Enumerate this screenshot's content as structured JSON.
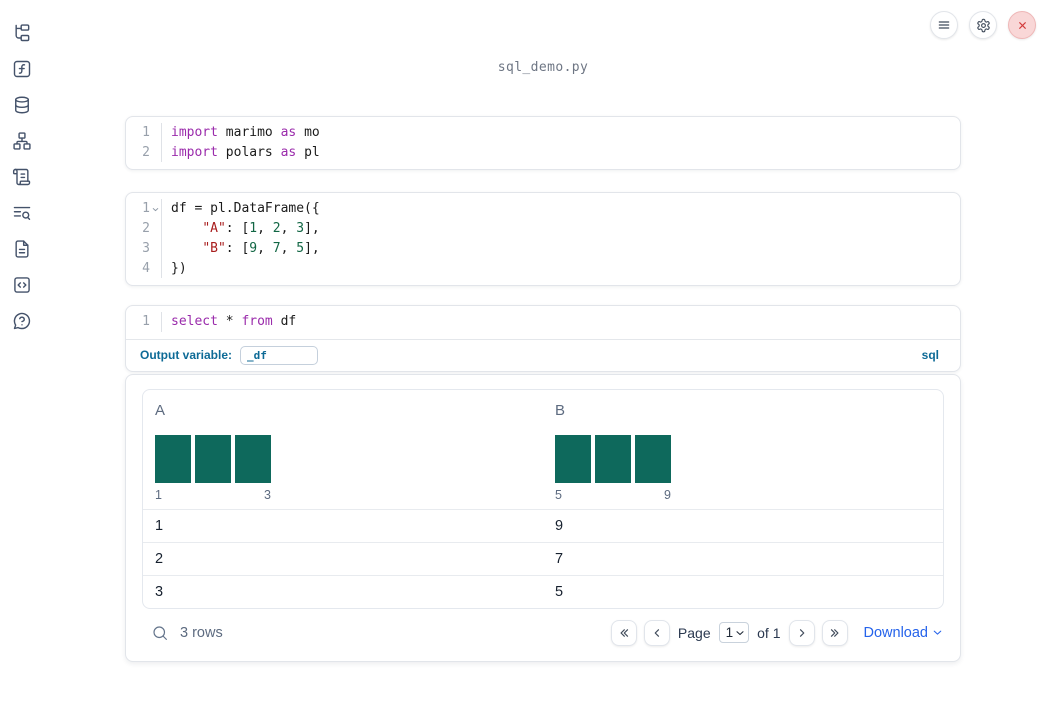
{
  "header": {
    "title": "sql_demo.py"
  },
  "sidebar": {
    "items": [
      {
        "name": "files-panel",
        "icon": "file-tree"
      },
      {
        "name": "variables-panel",
        "icon": "function-square"
      },
      {
        "name": "datasources-panel",
        "icon": "database"
      },
      {
        "name": "dependencies-panel",
        "icon": "dependency-graph"
      },
      {
        "name": "logs-panel",
        "icon": "scroll"
      },
      {
        "name": "outline-search-panel",
        "icon": "text-search"
      },
      {
        "name": "documentation-panel",
        "icon": "file-text"
      },
      {
        "name": "snippets-panel",
        "icon": "code-snippet"
      },
      {
        "name": "help-panel",
        "icon": "help-circle"
      }
    ]
  },
  "topbar": {
    "buttons": [
      {
        "name": "notebook-menu-button",
        "icon": "menu"
      },
      {
        "name": "settings-button",
        "icon": "settings"
      },
      {
        "name": "shutdown-button",
        "icon": "close",
        "danger": true
      }
    ]
  },
  "cells": [
    {
      "type": "code",
      "lines": [
        {
          "num": "1",
          "tokens": [
            {
              "t": "import",
              "c": "keyword"
            },
            {
              "t": " marimo ",
              "c": "plain"
            },
            {
              "t": "as",
              "c": "keyword"
            },
            {
              "t": " mo",
              "c": "plain"
            }
          ]
        },
        {
          "num": "2",
          "tokens": [
            {
              "t": "import",
              "c": "keyword"
            },
            {
              "t": " polars ",
              "c": "plain"
            },
            {
              "t": "as",
              "c": "keyword"
            },
            {
              "t": " pl",
              "c": "plain"
            }
          ]
        }
      ]
    },
    {
      "type": "code",
      "lines": [
        {
          "num": "1",
          "fold": true,
          "tokens": [
            {
              "t": "df = pl.DataFrame({",
              "c": "plain"
            }
          ]
        },
        {
          "num": "2",
          "tokens": [
            {
              "t": "    ",
              "c": "plain"
            },
            {
              "t": "\"A\"",
              "c": "string"
            },
            {
              "t": ": [",
              "c": "plain"
            },
            {
              "t": "1",
              "c": "number"
            },
            {
              "t": ", ",
              "c": "plain"
            },
            {
              "t": "2",
              "c": "number"
            },
            {
              "t": ", ",
              "c": "plain"
            },
            {
              "t": "3",
              "c": "number"
            },
            {
              "t": "],",
              "c": "plain"
            }
          ]
        },
        {
          "num": "3",
          "tokens": [
            {
              "t": "    ",
              "c": "plain"
            },
            {
              "t": "\"B\"",
              "c": "string"
            },
            {
              "t": ": [",
              "c": "plain"
            },
            {
              "t": "9",
              "c": "number"
            },
            {
              "t": ", ",
              "c": "plain"
            },
            {
              "t": "7",
              "c": "number"
            },
            {
              "t": ", ",
              "c": "plain"
            },
            {
              "t": "5",
              "c": "number"
            },
            {
              "t": "],",
              "c": "plain"
            }
          ]
        },
        {
          "num": "4",
          "tokens": [
            {
              "t": "})",
              "c": "plain"
            }
          ]
        }
      ]
    },
    {
      "type": "sql",
      "lines": [
        {
          "num": "1",
          "tokens": [
            {
              "t": "select",
              "c": "keyword"
            },
            {
              "t": " * ",
              "c": "plain"
            },
            {
              "t": "from",
              "c": "keyword"
            },
            {
              "t": " df",
              "c": "plain"
            }
          ]
        }
      ],
      "output_variable_label": "Output variable:",
      "output_variable_value": "_df",
      "language_badge": "sql"
    }
  ],
  "table_output": {
    "columns": [
      {
        "name": "A",
        "histogram": {
          "bar_heights": [
            1,
            1,
            1
          ],
          "min_label": "1",
          "max_label": "3"
        }
      },
      {
        "name": "B",
        "histogram": {
          "bar_heights": [
            1,
            1,
            1
          ],
          "min_label": "5",
          "max_label": "9"
        }
      }
    ],
    "rows": [
      [
        "1",
        "9"
      ],
      [
        "2",
        "7"
      ],
      [
        "3",
        "5"
      ]
    ],
    "row_count_text": "3 rows",
    "pagination": {
      "page_label": "Page",
      "page_value": "1",
      "of_label": "of 1"
    },
    "download_label": "Download"
  },
  "colors": {
    "histogram_bar": "#0e695c",
    "sql_accent": "#0d6a96",
    "download_link": "#2563eb",
    "keyword": "#9a2bab",
    "string": "#a81d1d",
    "number": "#116644",
    "close_button_bg": "#f9d7d7",
    "close_button_fg": "#d23b3b"
  }
}
